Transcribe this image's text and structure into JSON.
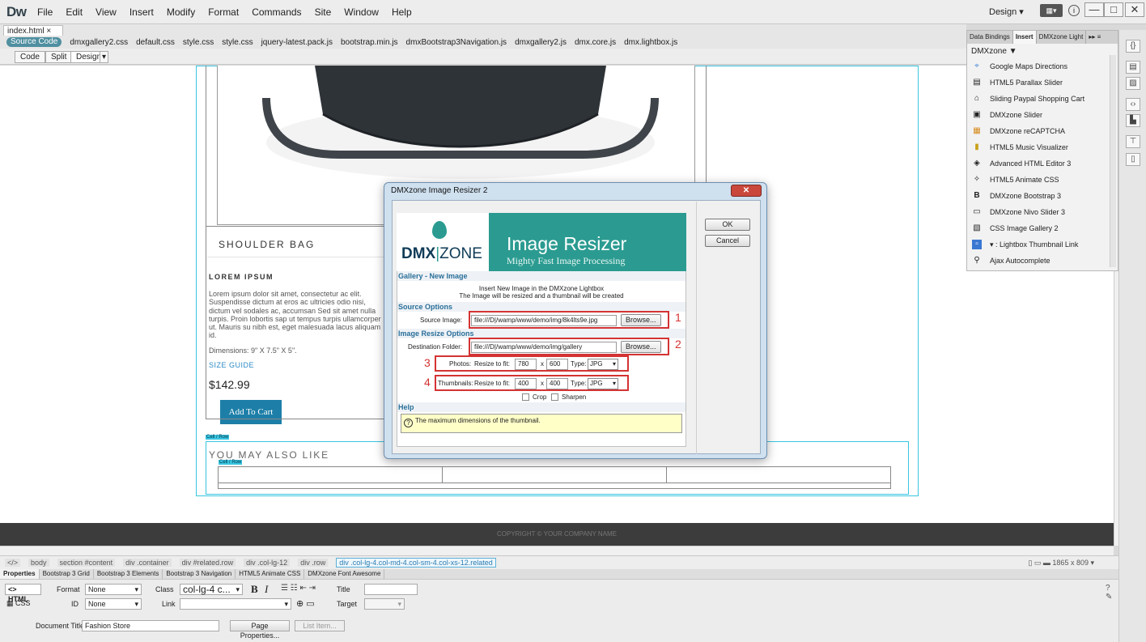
{
  "app": {
    "logo": "Dw",
    "menu": [
      "File",
      "Edit",
      "View",
      "Insert",
      "Modify",
      "Format",
      "Commands",
      "Site",
      "Window",
      "Help"
    ],
    "workspace": "Design",
    "window_controls": {
      "minimize": "—",
      "maximize": "□",
      "close": "✕"
    }
  },
  "doc_tab": "index.html  ×",
  "related_files": [
    "Source Code",
    "dmxgallery2.css",
    "default.css",
    "style.css",
    "style.css",
    "jquery-latest.pack.js",
    "bootstrap.min.js",
    "dmxBootstrap3Navigation.js",
    "dmxgallery2.js",
    "dmx.core.js",
    "dmx.lightbox.js"
  ],
  "view_buttons": {
    "code": "Code",
    "split": "Split",
    "design": "Design"
  },
  "page": {
    "product_title": "SHOULDER BAG",
    "subheading": "LOREM IPSUM",
    "description": "Lorem ipsum dolor sit amet, consectetur ac elit. Suspendisse dictum at eros ac ultricies odio nisi, dictum vel sodales ac, accumsan Sed sit amet nulla turpis. Proin lobortis sap ut tempus turpis ullamcorper ut. Mauris su nibh est, eget malesuada lacus aliquam id.",
    "dimensions": "Dimensions: 9\" X 7.5\" X 5\".",
    "size_guide": "SIZE GUIDE",
    "price": "$142.99",
    "add_to_cart": "Add To Cart",
    "cell_row_1": "Cell / Row",
    "you_may_also_like": "YOU MAY ALSO LIKE",
    "cell_row_2": "Cell / Row",
    "copyright": "COPYRIGHT © YOUR COMPANY NAME"
  },
  "tag_selector": [
    "</>",
    "body",
    "section #content",
    "div .container",
    "div #related.row",
    "div .col-lg-12",
    "div .row",
    "div .col-lg-4.col-md-4.col-sm-4.col-xs-12.related"
  ],
  "viewport_size": "1865 x 809",
  "prop_tabs": [
    "Properties",
    "Bootstrap 3 Grid",
    "Bootstrap 3 Elements",
    "Bootstrap 3 Navigation",
    "HTML5 Animate CSS",
    "DMXzone Font Awesome"
  ],
  "props": {
    "html_btn": "<> HTML",
    "css_btn": "CSS",
    "format_label": "Format",
    "format_value": "None",
    "class_label": "Class",
    "class_value": "col-lg-4 c...",
    "id_label": "ID",
    "id_value": "None",
    "link_label": "Link",
    "title_label": "Title",
    "target_label": "Target",
    "doc_title_label": "Document Title",
    "doc_title_value": "Fashion Store",
    "page_properties": "Page Properties...",
    "list_item": "List Item..."
  },
  "panel": {
    "tabs": [
      "Data Bindings",
      "Insert",
      "DMXzone Light"
    ],
    "category": "DMXzone",
    "items": [
      {
        "icon": "map-pin-icon",
        "label": "Google Maps Directions"
      },
      {
        "icon": "parallax-icon",
        "label": "HTML5 Parallax Slider"
      },
      {
        "icon": "cart-icon",
        "label": "Sliding Paypal Shopping Cart"
      },
      {
        "icon": "slider-icon",
        "label": "DMXzone Slider"
      },
      {
        "icon": "captcha-icon",
        "label": "DMXzone reCAPTCHA"
      },
      {
        "icon": "music-icon",
        "label": "HTML5 Music Visualizer"
      },
      {
        "icon": "editor-icon",
        "label": "Advanced HTML Editor 3"
      },
      {
        "icon": "animate-icon",
        "label": "HTML5 Animate CSS"
      },
      {
        "icon": "bootstrap-icon",
        "label": "DMXzone Bootstrap 3"
      },
      {
        "icon": "nivo-icon",
        "label": "DMXzone Nivo Slider 3"
      },
      {
        "icon": "gallery-icon",
        "label": "CSS Image Gallery 2"
      },
      {
        "icon": "lightbox-icon",
        "label": ": Lightbox Thumbnail Link"
      },
      {
        "icon": "search-icon",
        "label": "Ajax Autocomplete"
      }
    ]
  },
  "dialog": {
    "title": "DMXzone Image Resizer 2",
    "close": "✕",
    "brand_dmx": "DMX",
    "brand_zone": "ZONE",
    "banner_title": "Image Resizer",
    "banner_sub": "Mighty Fast Image Processing",
    "ok": "OK",
    "cancel": "Cancel",
    "section_new": "Gallery - New Image",
    "info_line1": "Insert New Image in the DMXzone Lightbox",
    "info_line2": "The Image will be resized and a thumbnail will be created",
    "section_source": "Source Options",
    "source_label": "Source Image:",
    "source_value": "file:///D|/wamp/www/demo/img/8k4lts9e.jpg",
    "browse1": "Browse...",
    "section_resize": "Image Resize Options",
    "dest_label": "Destination Folder:",
    "dest_value": "file:///D|/wamp/www/demo/img/gallery",
    "browse2": "Browse...",
    "photos_label": "Photos:",
    "photos_fit": "Resize to fit:",
    "photos_w": "780",
    "photos_x": "x",
    "photos_h": "600",
    "photos_type_label": "Type:",
    "photos_type": "JPG",
    "thumbs_label": "Thumbnails:",
    "thumbs_fit": "Resize to fit:",
    "thumbs_w": "400",
    "thumbs_x": "x",
    "thumbs_h": "400",
    "thumbs_type_label": "Type:",
    "thumbs_type": "JPG",
    "crop": "Crop",
    "sharpen": "Sharpen",
    "section_help": "Help",
    "help_text": "The maximum dimensions of the thumbnail.",
    "marker1": "1",
    "marker2": "2",
    "marker3": "3",
    "marker4": "4"
  }
}
